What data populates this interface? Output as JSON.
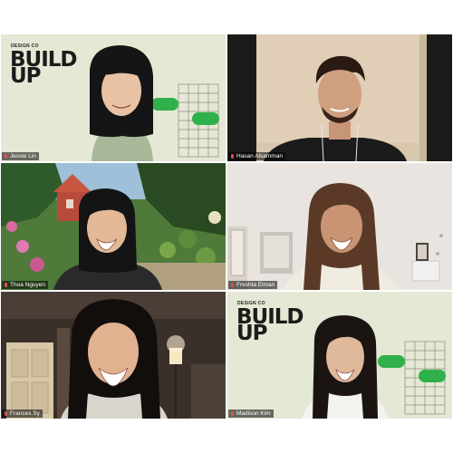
{
  "participants": [
    {
      "name": "Jessie Lin"
    },
    {
      "name": "Hasan Alsamman"
    },
    {
      "name": "Thoa Nguyen"
    },
    {
      "name": "Freshta Elman"
    },
    {
      "name": "Frances Sy"
    },
    {
      "name": "Madison Kim"
    }
  ],
  "background_brand": {
    "kicker": "DESIGN CO",
    "headline_line1": "BUILD",
    "headline_line2": "UP"
  },
  "colors": {
    "brand_bg": "#e4e8d4",
    "brand_green": "#2fb04b",
    "name_tag_bg": "#000000",
    "muted_mic": "#e05050"
  },
  "icons": [
    "mic-muted-icon"
  ]
}
